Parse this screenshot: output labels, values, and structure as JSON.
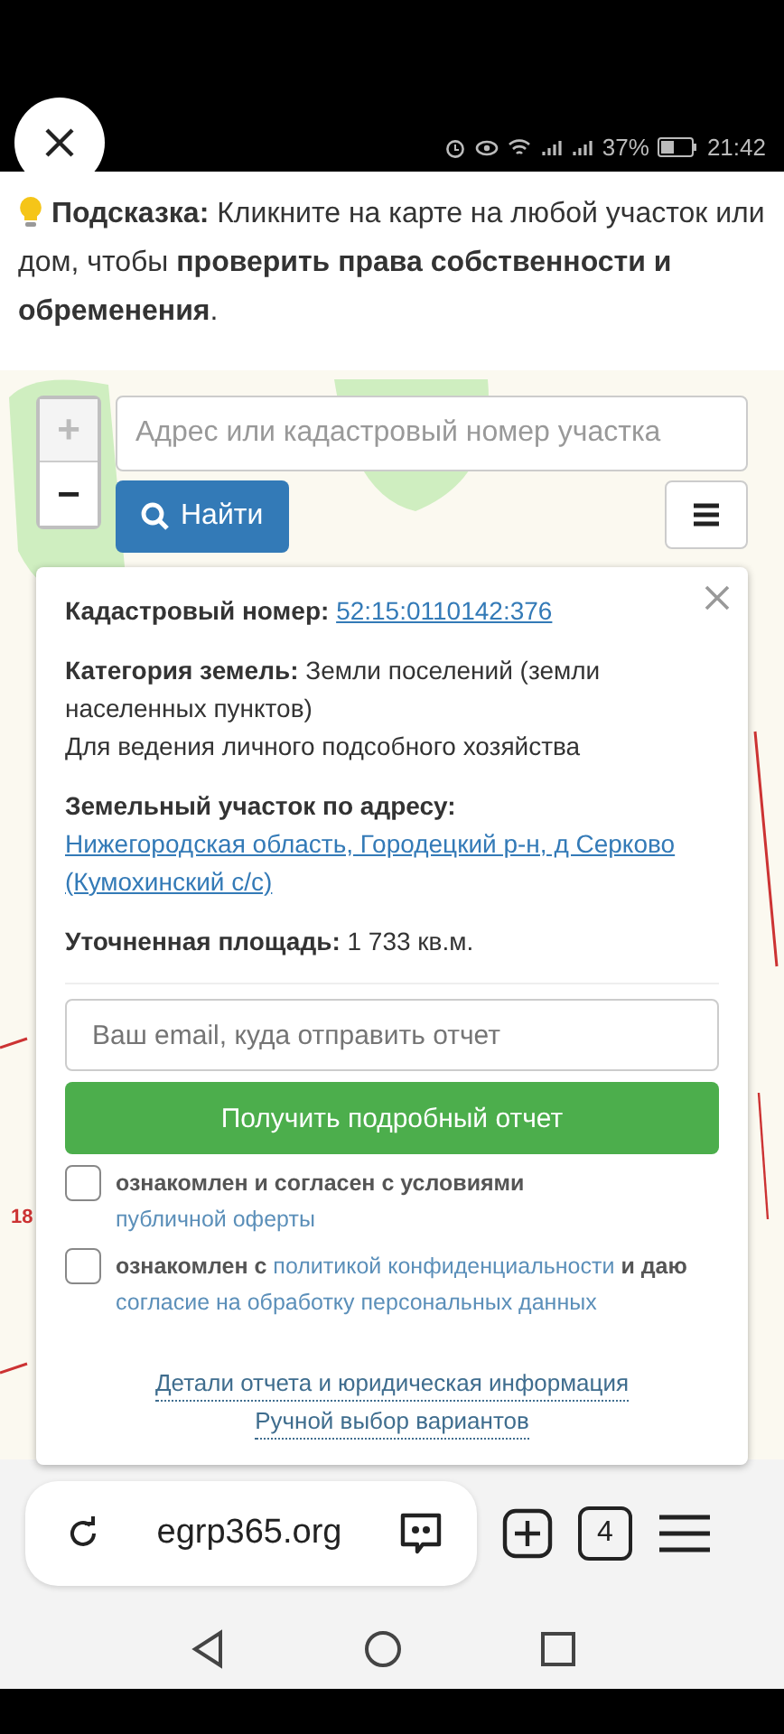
{
  "status_bar": {
    "battery": "37%",
    "time": "21:42"
  },
  "hint": {
    "text": "**Подсказка:** Кликните на карте на любой участок или дом, чтобы **проверить права собственности и обременения**."
  },
  "map": {
    "map_label": "18",
    "zoom_in": "+",
    "zoom_out": "−",
    "search": {
      "placeholder": "Адрес или кадастровый номер участка"
    },
    "find_button": "Найти"
  },
  "popup": {
    "cadastral_label": "Кадастровый номер:",
    "cadastral_number": "52:15:0110142:376",
    "category_label": "Категория земель:",
    "category_value": "Земли поселений (земли населенных пунктов)",
    "usage": "Для ведения личного подсобного хозяйства",
    "address_label": "Земельный участок по адресу:",
    "address_value": "Нижегородская область, Городецкий р-н, д Серково (Кумохинский с/с)",
    "area_label": "Уточненная площадь:",
    "area_value": "1 733 кв.м.",
    "email": {
      "placeholder": "Ваш email, куда отправить отчет"
    },
    "submit_button": "Получить подробный отчет",
    "agreements": [
      {
        "checked": false,
        "parts": [
          {
            "kind": "text",
            "text": "ознакомлен и согласен с условиями "
          },
          {
            "kind": "link",
            "text": "публичной оферты"
          }
        ]
      },
      {
        "checked": false,
        "parts": [
          {
            "kind": "text",
            "text": "ознакомлен с "
          },
          {
            "kind": "link",
            "text": "политикой конфиденциальности"
          },
          {
            "kind": "text",
            "text": " и даю "
          },
          {
            "kind": "link",
            "text": "согласие на обработку персональных данных"
          }
        ]
      }
    ],
    "footer_links": [
      "Детали отчета и юридическая информация",
      "Ручной выбор вариантов"
    ]
  },
  "browser": {
    "url": "egrp365.org",
    "tab_count": "4"
  }
}
